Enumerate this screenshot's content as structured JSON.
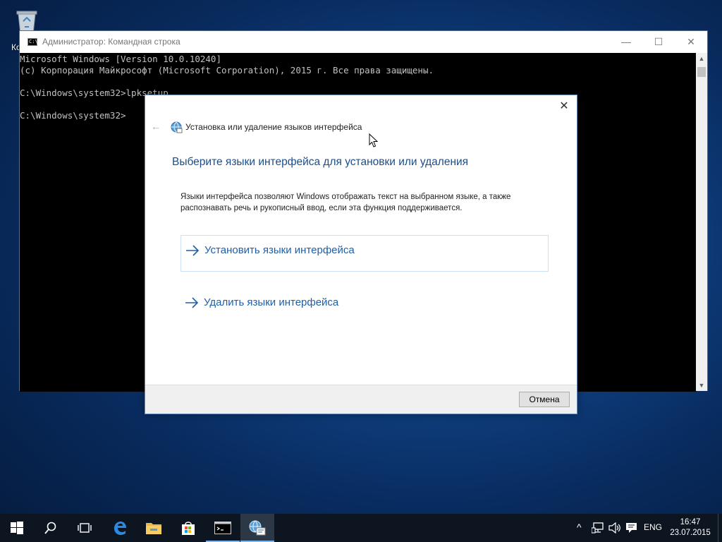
{
  "desktop": {
    "recycle_bin_label": "Ко"
  },
  "console": {
    "title": "Администратор: Командная строка",
    "icon_text": "C:\\_",
    "controls": {
      "minimize": "—",
      "maximize": "☐",
      "close": "✕"
    },
    "lines": [
      "Microsoft Windows [Version 10.0.10240]",
      "(c) Корпорация Майкрософт (Microsoft Corporation), 2015 г. Все права защищены.",
      "",
      "C:\\Windows\\system32>lpksetup",
      "",
      "C:\\Windows\\system32>"
    ]
  },
  "dialog": {
    "close_glyph": "✕",
    "back_glyph": "←",
    "breadcrumb": "Установка или удаление языков интерфейса",
    "heading": "Выберите языки интерфейса для установки или удаления",
    "description": "Языки интерфейса позволяют Windows отображать текст на выбранном языке, а также распознавать речь и рукописный ввод, если эта функция поддерживается.",
    "options": [
      {
        "label": "Установить языки интерфейса"
      },
      {
        "label": "Удалить языки интерфейса"
      }
    ],
    "cancel_label": "Отмена",
    "accent_color": "#1e5fa8"
  },
  "taskbar": {
    "items": [
      {
        "name": "start-button",
        "icon": "windows-logo-icon"
      },
      {
        "name": "search-button",
        "icon": "search-icon"
      },
      {
        "name": "task-view-button",
        "icon": "task-view-icon"
      },
      {
        "name": "edge-button",
        "icon": "edge-icon"
      },
      {
        "name": "file-explorer-button",
        "icon": "folder-icon"
      },
      {
        "name": "store-button",
        "icon": "store-icon"
      },
      {
        "name": "command-prompt-button",
        "icon": "console-icon"
      },
      {
        "name": "language-setup-button",
        "icon": "language-setup-icon"
      }
    ],
    "tray": {
      "chevron": "^",
      "language": "ENG",
      "time": "16:47",
      "date": "23.07.2015"
    }
  }
}
